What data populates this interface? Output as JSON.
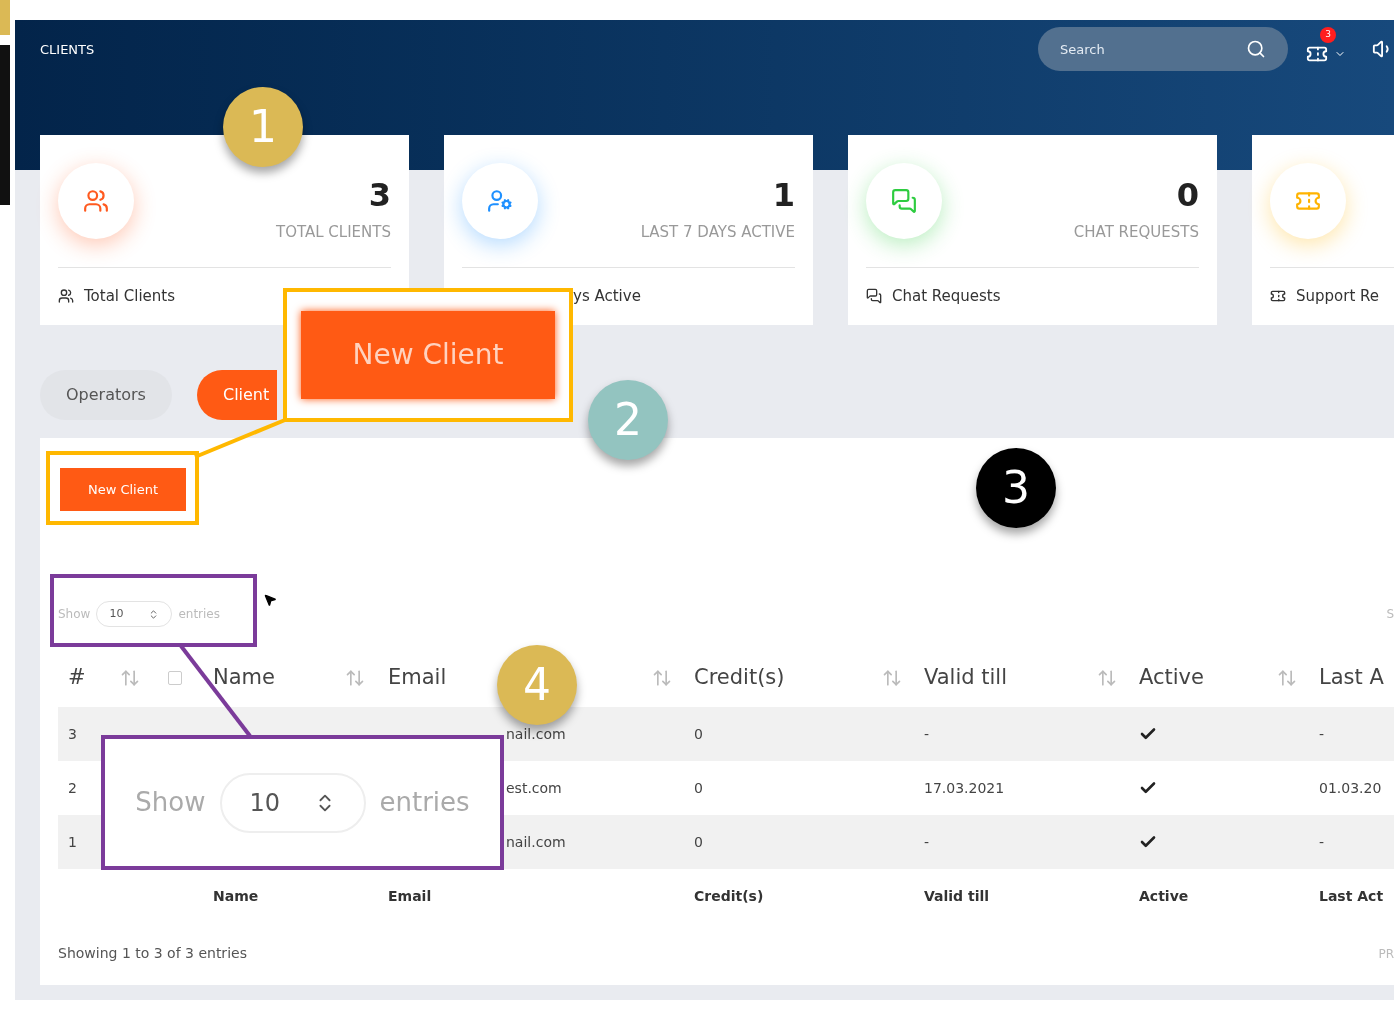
{
  "header": {
    "title": "CLIENTS",
    "search": {
      "placeholder": "Search"
    },
    "notification_count": "3"
  },
  "cards": [
    {
      "kind": "users",
      "color": "#ff5a1f",
      "value": "3",
      "label": "TOTAL CLIENTS",
      "footer": "Total Clients",
      "footer_icon": true
    },
    {
      "kind": "user-gear",
      "color": "#1e90ff",
      "value": "1",
      "label": "LAST 7 DAYS ACTIVE",
      "footer": "ys Active",
      "footer_icon": false
    },
    {
      "kind": "chat",
      "color": "#2ecc40",
      "value": "0",
      "label": "CHAT REQUESTS",
      "footer": "Chat Requests",
      "footer_icon": true
    },
    {
      "kind": "ticket",
      "color": "#ffb300",
      "footer": "Support Re",
      "footer_icon": true
    }
  ],
  "tabs": [
    {
      "label": "Operators",
      "selected": false
    },
    {
      "label": "Client",
      "selected": true
    }
  ],
  "table_panel": {
    "new_button": "New Client",
    "show": "Show",
    "page_size": "10",
    "entries": "entries",
    "search_label": "S",
    "select_all": {
      "checked": false
    },
    "columns": [
      "#",
      "Name",
      "Email",
      "Credit(s)",
      "Valid till",
      "Active",
      "Last A"
    ],
    "rows": [
      {
        "number": "3",
        "email": "nail.com",
        "credits": "0",
        "valid_till": "-",
        "active": true,
        "last": "-"
      },
      {
        "number": "2",
        "email": "est.com",
        "credits": "0",
        "valid_till": "17.03.2021",
        "active": true,
        "last": "01.03.20"
      },
      {
        "number": "1",
        "email": "nail.com",
        "credits": "0",
        "valid_till": "-",
        "active": true,
        "last": "-"
      }
    ],
    "footer_columns": [
      "Name",
      "Email",
      "Credit(s)",
      "Valid till",
      "Active",
      "Last Act"
    ],
    "info": "Showing 1 to 3 of 3 entries",
    "pager": "PR"
  },
  "callouts": [
    {
      "number": "1",
      "color": "#dbb955"
    },
    {
      "number": "2",
      "color": "#93c4c0"
    },
    {
      "number": "3",
      "color": "#000000"
    },
    {
      "number": "4",
      "color": "#dbb955"
    }
  ],
  "zoom_boxes": [
    {
      "kind": "button",
      "text": "New Client"
    },
    {
      "kind": "entries",
      "show": "Show",
      "value": "10",
      "entries": "entries"
    }
  ]
}
